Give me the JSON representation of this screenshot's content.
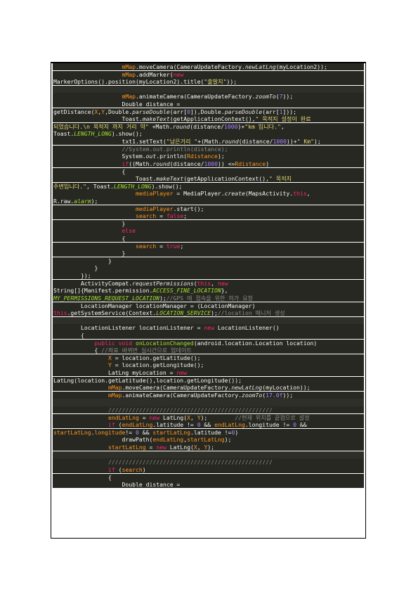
{
  "document": {
    "code_lines": [
      {
        "indent": 20,
        "segments": [
          [
            "field",
            "mMap"
          ],
          [
            "plain",
            ".moveCamera(CameraUpdateFactory."
          ],
          [
            "ital",
            "newLatLng"
          ],
          [
            "plain",
            "(myLocation2));"
          ]
        ]
      },
      {
        "indent": 20,
        "segments": [
          [
            "field",
            "mMap"
          ],
          [
            "plain",
            ".addMarker("
          ],
          [
            "kw",
            "new"
          ]
        ]
      },
      {
        "indent": 0,
        "segments": [
          [
            "plain",
            "MarkerOptions().position(myLocation2).title("
          ],
          [
            "str",
            "\"출발지\""
          ],
          [
            "plain",
            "));"
          ]
        ]
      },
      {
        "indent": 0,
        "segments": []
      },
      {
        "indent": 20,
        "segments": [
          [
            "field",
            "mMap"
          ],
          [
            "plain",
            ".animateCamera(CameraUpdateFactory."
          ],
          [
            "ital",
            "zoomTo"
          ],
          [
            "plain",
            "("
          ],
          [
            "num",
            "7"
          ],
          [
            "plain",
            "));"
          ]
        ]
      },
      {
        "indent": 20,
        "segments": [
          [
            "plain",
            "Double distance ="
          ]
        ]
      },
      {
        "indent": 0,
        "segments": [
          [
            "plain",
            "getDistance("
          ],
          [
            "field",
            "X"
          ],
          [
            "plain",
            ","
          ],
          [
            "field",
            "Y"
          ],
          [
            "plain",
            ",Double."
          ],
          [
            "ital",
            "parseDouble"
          ],
          [
            "plain",
            "(arr["
          ],
          [
            "num",
            "0"
          ],
          [
            "plain",
            "]),Double."
          ],
          [
            "ital",
            "parseDouble"
          ],
          [
            "plain",
            "(arr["
          ],
          [
            "num",
            "1"
          ],
          [
            "plain",
            "]));"
          ]
        ]
      },
      {
        "indent": 20,
        "segments": [
          [
            "plain",
            "Toast."
          ],
          [
            "ital",
            "makeText"
          ],
          [
            "plain",
            "(getApplicationContext(),"
          ],
          [
            "str",
            "\" 목적지 설정이 완료"
          ]
        ]
      },
      {
        "indent": 0,
        "segments": [
          [
            "str",
            "되었습니다.\\n 목적지 까지 거리 약\""
          ],
          [
            "plain",
            " +Math."
          ],
          [
            "ital",
            "round"
          ],
          [
            "plain",
            "(distance/"
          ],
          [
            "num",
            "1000"
          ],
          [
            "plain",
            ")+"
          ],
          [
            "str",
            "\"km 입니다.\""
          ],
          [
            "plain",
            ","
          ]
        ]
      },
      {
        "indent": 0,
        "segments": [
          [
            "plain",
            "Toast."
          ],
          [
            "const",
            "LENGTH_LONG"
          ],
          [
            "plain",
            ").show();"
          ]
        ]
      },
      {
        "indent": 20,
        "segments": [
          [
            "plain",
            "txt1.setText("
          ],
          [
            "str",
            "\"남은거리 \""
          ],
          [
            "plain",
            "+(Math."
          ],
          [
            "ital",
            "round"
          ],
          [
            "plain",
            "(distance/"
          ],
          [
            "num",
            "1000"
          ],
          [
            "plain",
            "))+"
          ],
          [
            "str",
            "\" Km\""
          ],
          [
            "plain",
            ");"
          ]
        ]
      },
      {
        "indent": 20,
        "segments": [
          [
            "cm",
            "//System.out.println(distance);"
          ]
        ]
      },
      {
        "indent": 20,
        "segments": [
          [
            "plain",
            "System."
          ],
          [
            "ital",
            "out"
          ],
          [
            "plain",
            ".println("
          ],
          [
            "field",
            "Rdistance"
          ],
          [
            "plain",
            ");"
          ]
        ]
      },
      {
        "indent": 20,
        "segments": [
          [
            "kw",
            "if"
          ],
          [
            "plain",
            "((Math."
          ],
          [
            "ital",
            "round"
          ],
          [
            "plain",
            "(distance/"
          ],
          [
            "num",
            "1000"
          ],
          [
            "plain",
            ")) <="
          ],
          [
            "field",
            "Rdistance"
          ],
          [
            "plain",
            ")"
          ]
        ]
      },
      {
        "indent": 20,
        "segments": [
          [
            "plain",
            "{"
          ]
        ]
      },
      {
        "indent": 24,
        "segments": [
          [
            "plain",
            "Toast."
          ],
          [
            "ital",
            "makeText"
          ],
          [
            "plain",
            "(getApplicationContext(),"
          ],
          [
            "str",
            "\" 목적지"
          ]
        ]
      },
      {
        "indent": 0,
        "segments": [
          [
            "str",
            "주변입니다.\""
          ],
          [
            "plain",
            ", Toast."
          ],
          [
            "const",
            "LENGTH_LONG"
          ],
          [
            "plain",
            ").show();"
          ]
        ]
      },
      {
        "indent": 24,
        "segments": [
          [
            "field",
            "mediaPlayer"
          ],
          [
            "plain",
            " = MediaPlayer."
          ],
          [
            "ital",
            "create"
          ],
          [
            "plain",
            "(MapsActivity."
          ],
          [
            "kw",
            "this"
          ],
          [
            "plain",
            ","
          ]
        ]
      },
      {
        "indent": 0,
        "segments": [
          [
            "plain",
            "R.raw."
          ],
          [
            "const",
            "alarm"
          ],
          [
            "plain",
            ");"
          ]
        ]
      },
      {
        "indent": 24,
        "segments": [
          [
            "field",
            "mediaPlayer"
          ],
          [
            "plain",
            ".start();"
          ]
        ]
      },
      {
        "indent": 24,
        "segments": [
          [
            "field",
            "search"
          ],
          [
            "plain",
            " = "
          ],
          [
            "kw",
            "false"
          ],
          [
            "plain",
            ";"
          ]
        ]
      },
      {
        "indent": 20,
        "segments": [
          [
            "plain",
            "}"
          ]
        ]
      },
      {
        "indent": 20,
        "segments": [
          [
            "kw",
            "else"
          ]
        ]
      },
      {
        "indent": 20,
        "segments": [
          [
            "plain",
            "{"
          ]
        ]
      },
      {
        "indent": 24,
        "segments": [
          [
            "field",
            "search"
          ],
          [
            "plain",
            " = "
          ],
          [
            "kw",
            "true"
          ],
          [
            "plain",
            ";"
          ]
        ]
      },
      {
        "indent": 20,
        "segments": [
          [
            "plain",
            "}"
          ]
        ]
      },
      {
        "indent": 16,
        "segments": [
          [
            "plain",
            "}"
          ]
        ]
      },
      {
        "indent": 12,
        "segments": [
          [
            "plain",
            "}"
          ]
        ]
      },
      {
        "indent": 8,
        "segments": [
          [
            "plain",
            "});"
          ]
        ]
      },
      {
        "indent": 8,
        "segments": [
          [
            "plain",
            "ActivityCompat."
          ],
          [
            "ital",
            "requestPermissions"
          ],
          [
            "plain",
            "("
          ],
          [
            "kw",
            "this"
          ],
          [
            "plain",
            ", "
          ],
          [
            "kw",
            "new"
          ]
        ]
      },
      {
        "indent": 0,
        "segments": [
          [
            "plain",
            "String[]{Manifest.permission."
          ],
          [
            "const",
            "ACCESS_FINE_LOCATION"
          ],
          [
            "plain",
            "},"
          ]
        ]
      },
      {
        "indent": 0,
        "segments": [
          [
            "const",
            "MY_PERMISSIONS_REQUEST_LOCATION"
          ],
          [
            "plain",
            ");"
          ],
          [
            "cm",
            "//GPS 에 접속을 위한 허가 요청"
          ]
        ]
      },
      {
        "indent": 8,
        "segments": [
          [
            "plain",
            "LocationManager locationManager = (LocationManager)"
          ]
        ]
      },
      {
        "indent": 0,
        "segments": [
          [
            "kw",
            "this"
          ],
          [
            "plain",
            ".getSystemService(Context."
          ],
          [
            "const",
            "LOCATION_SERVICE"
          ],
          [
            "plain",
            ");"
          ],
          [
            "cm",
            "//location 매니저 생성"
          ]
        ]
      },
      {
        "indent": 0,
        "segments": []
      },
      {
        "indent": 8,
        "segments": [
          [
            "plain",
            "LocationListener locationListener = "
          ],
          [
            "kw",
            "new"
          ],
          [
            "plain",
            " LocationListener()"
          ]
        ]
      },
      {
        "indent": 8,
        "segments": [
          [
            "plain",
            "{"
          ]
        ]
      },
      {
        "indent": 12,
        "segments": [
          [
            "kw",
            "public void "
          ],
          [
            "fn",
            "onLocationChanged"
          ],
          [
            "plain",
            "(android.location.Location location)"
          ]
        ]
      },
      {
        "indent": 12,
        "segments": [
          [
            "plain",
            "{ "
          ],
          [
            "cm",
            "//좌표 바뀌면 실시간으로 업데이트"
          ]
        ]
      },
      {
        "indent": 16,
        "segments": [
          [
            "field",
            "X"
          ],
          [
            "plain",
            " = location.getLatitude();"
          ]
        ]
      },
      {
        "indent": 16,
        "segments": [
          [
            "field",
            "Y"
          ],
          [
            "plain",
            " = location.getLongitude();"
          ]
        ]
      },
      {
        "indent": 16,
        "segments": [
          [
            "plain",
            "LatLng myLocation = "
          ],
          [
            "kw",
            "new"
          ]
        ]
      },
      {
        "indent": 0,
        "segments": [
          [
            "plain",
            "LatLng(location.getLatitude(),location.getLongitude());"
          ]
        ]
      },
      {
        "indent": 16,
        "segments": [
          [
            "field",
            "mMap"
          ],
          [
            "plain",
            ".moveCamera(CameraUpdateFactory."
          ],
          [
            "ital",
            "newLatLng"
          ],
          [
            "plain",
            "(myLocation));"
          ]
        ]
      },
      {
        "indent": 16,
        "segments": [
          [
            "field",
            "mMap"
          ],
          [
            "plain",
            ".animateCamera(CameraUpdateFactory."
          ],
          [
            "ital",
            "zoomTo"
          ],
          [
            "plain",
            "("
          ],
          [
            "num",
            "17.0f"
          ],
          [
            "plain",
            "));"
          ]
        ]
      },
      {
        "indent": 0,
        "segments": []
      },
      {
        "indent": 16,
        "segments": [
          [
            "cm",
            "////////////////////////////////////////////////"
          ]
        ]
      },
      {
        "indent": 16,
        "segments": [
          [
            "field",
            "endLatLng"
          ],
          [
            "plain",
            " = "
          ],
          [
            "kw",
            "new"
          ],
          [
            "plain",
            " LatLng("
          ],
          [
            "field",
            "X"
          ],
          [
            "plain",
            ", "
          ],
          [
            "field",
            "Y"
          ],
          [
            "plain",
            ");        "
          ],
          [
            "cm",
            "//현재 위치를 끝점으로 설정"
          ]
        ]
      },
      {
        "indent": 16,
        "segments": [
          [
            "kw",
            "if"
          ],
          [
            "plain",
            " ("
          ],
          [
            "field",
            "endLatLng"
          ],
          [
            "plain",
            ".latitude != "
          ],
          [
            "num",
            "0"
          ],
          [
            "plain",
            " && "
          ],
          [
            "field",
            "endLatLng"
          ],
          [
            "plain",
            ".longitude != "
          ],
          [
            "num",
            "0"
          ],
          [
            "plain",
            " &&"
          ]
        ]
      },
      {
        "indent": 0,
        "segments": [
          [
            "field",
            "startLatLng"
          ],
          [
            "plain",
            "."
          ],
          [
            "field",
            "longitude"
          ],
          [
            "plain",
            "!= "
          ],
          [
            "num",
            "0"
          ],
          [
            "plain",
            " && "
          ],
          [
            "field",
            "startLatLng"
          ],
          [
            "plain",
            ".latitude !="
          ],
          [
            "num",
            "0"
          ],
          [
            "plain",
            ")"
          ]
        ]
      },
      {
        "indent": 20,
        "segments": [
          [
            "plain",
            "drawPath("
          ],
          [
            "field",
            "endLatLng"
          ],
          [
            "plain",
            ","
          ],
          [
            "field",
            "startLatLng"
          ],
          [
            "plain",
            ");"
          ]
        ]
      },
      {
        "indent": 16,
        "segments": [
          [
            "field",
            "startLatLng"
          ],
          [
            "plain",
            " = "
          ],
          [
            "kw",
            "new"
          ],
          [
            "plain",
            " LatLng("
          ],
          [
            "field",
            "X"
          ],
          [
            "plain",
            ", "
          ],
          [
            "field",
            "Y"
          ],
          [
            "plain",
            ");"
          ]
        ]
      },
      {
        "indent": 0,
        "segments": []
      },
      {
        "indent": 16,
        "segments": [
          [
            "cm",
            "////////////////////////////////////////////////"
          ]
        ]
      },
      {
        "indent": 16,
        "segments": [
          [
            "kw",
            "if"
          ],
          [
            "plain",
            " ("
          ],
          [
            "field",
            "search"
          ],
          [
            "plain",
            ")"
          ]
        ]
      },
      {
        "indent": 16,
        "segments": [
          [
            "plain",
            "{"
          ]
        ]
      },
      {
        "indent": 20,
        "segments": [
          [
            "plain",
            "Double distance ="
          ]
        ]
      }
    ]
  }
}
